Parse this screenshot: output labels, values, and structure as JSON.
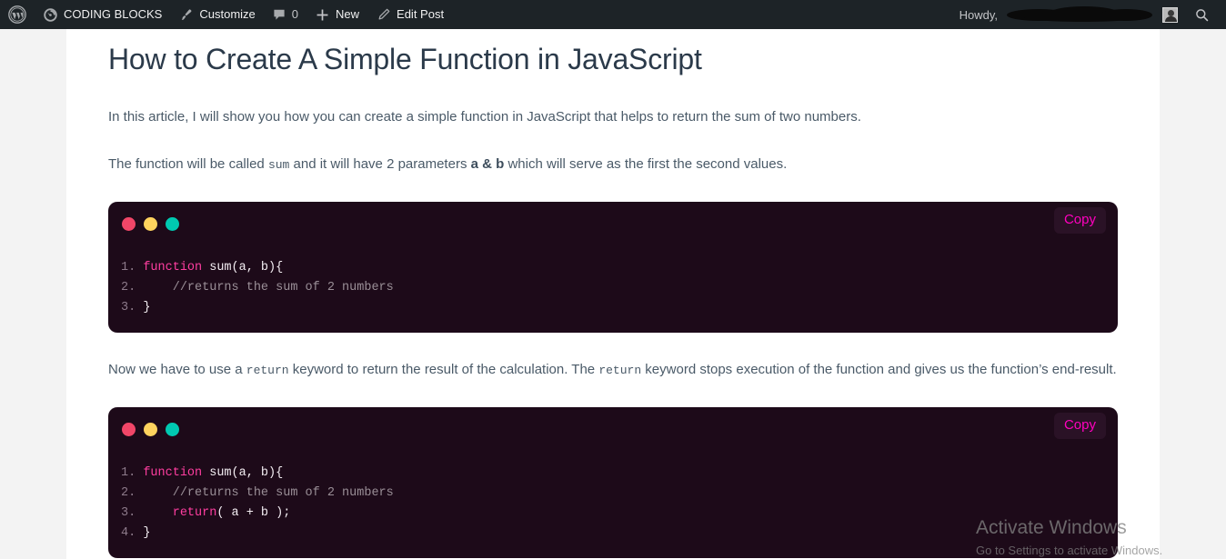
{
  "adminbar": {
    "wp_logo_icon": "wordpress-logo-icon",
    "items": [
      {
        "icon": "dashboard-gauge-icon",
        "label": "CODING BLOCKS"
      },
      {
        "icon": "paintbrush-icon",
        "label": "Customize"
      },
      {
        "icon": "comment-bubble-icon",
        "label": "0"
      },
      {
        "icon": "plus-icon",
        "label": "New"
      },
      {
        "icon": "pencil-icon",
        "label": "Edit Post"
      }
    ],
    "howdy_label": "Howdy,",
    "howdy_name": "",
    "avatar_icon": "user-avatar-icon",
    "search_icon": "search-icon"
  },
  "post": {
    "title": "How to Create A Simple Function in JavaScript",
    "paragraph_1": "In this article, I will show you how you can create a simple function in JavaScript that helps to return the sum of two numbers.",
    "paragraph_2": {
      "part_1": "The function will be called ",
      "code_1": "sum",
      "part_2": " and it will have 2 parameters ",
      "bold_1": "a & b",
      "part_3": " which will serve as the first the second values."
    },
    "paragraph_3": {
      "part_1": "Now we have to use a ",
      "code_1": "return",
      "part_2": " keyword to return the result of the calculation. The ",
      "code_2": "return",
      "part_3": " keyword stops execution of the function and gives us the function’s end-result."
    }
  },
  "codeblocks": [
    {
      "copy_label": "Copy",
      "dots": [
        "red",
        "yellow",
        "teal"
      ],
      "lines": [
        {
          "num": "1.",
          "tokens": [
            {
              "t": "kw",
              "v": "function"
            },
            {
              "t": "txt",
              "v": " sum(a, b){"
            }
          ]
        },
        {
          "num": "2.",
          "tokens": [
            {
              "t": "cmt",
              "v": "    //returns the sum of 2 numbers"
            }
          ]
        },
        {
          "num": "3.",
          "tokens": [
            {
              "t": "txt",
              "v": "}"
            }
          ]
        }
      ]
    },
    {
      "copy_label": "Copy",
      "dots": [
        "red",
        "yellow",
        "teal"
      ],
      "lines": [
        {
          "num": "1.",
          "tokens": [
            {
              "t": "kw",
              "v": "function"
            },
            {
              "t": "txt",
              "v": " sum(a, b){"
            }
          ]
        },
        {
          "num": "2.",
          "tokens": [
            {
              "t": "cmt",
              "v": "    //returns the sum of 2 numbers"
            }
          ]
        },
        {
          "num": "3.",
          "tokens": [
            {
              "t": "txt",
              "v": "    "
            },
            {
              "t": "kw",
              "v": "return"
            },
            {
              "t": "txt",
              "v": "( a + b );"
            }
          ]
        },
        {
          "num": "4.",
          "tokens": [
            {
              "t": "txt",
              "v": "}"
            }
          ]
        }
      ]
    }
  ],
  "watermark": {
    "title": "Activate Windows",
    "subtitle": "Go to Settings to activate Windows."
  },
  "colors": {
    "adminbar_bg": "#1d2327",
    "code_bg": "#1d0a19",
    "copy_text": "#ff00bf",
    "keyword": "#ff3ea0",
    "dot_red": "#f14668",
    "dot_yellow": "#ffd35e",
    "dot_teal": "#00c9b1",
    "page_gutter": "#f3f3f3",
    "body_text": "#4a5a68"
  }
}
